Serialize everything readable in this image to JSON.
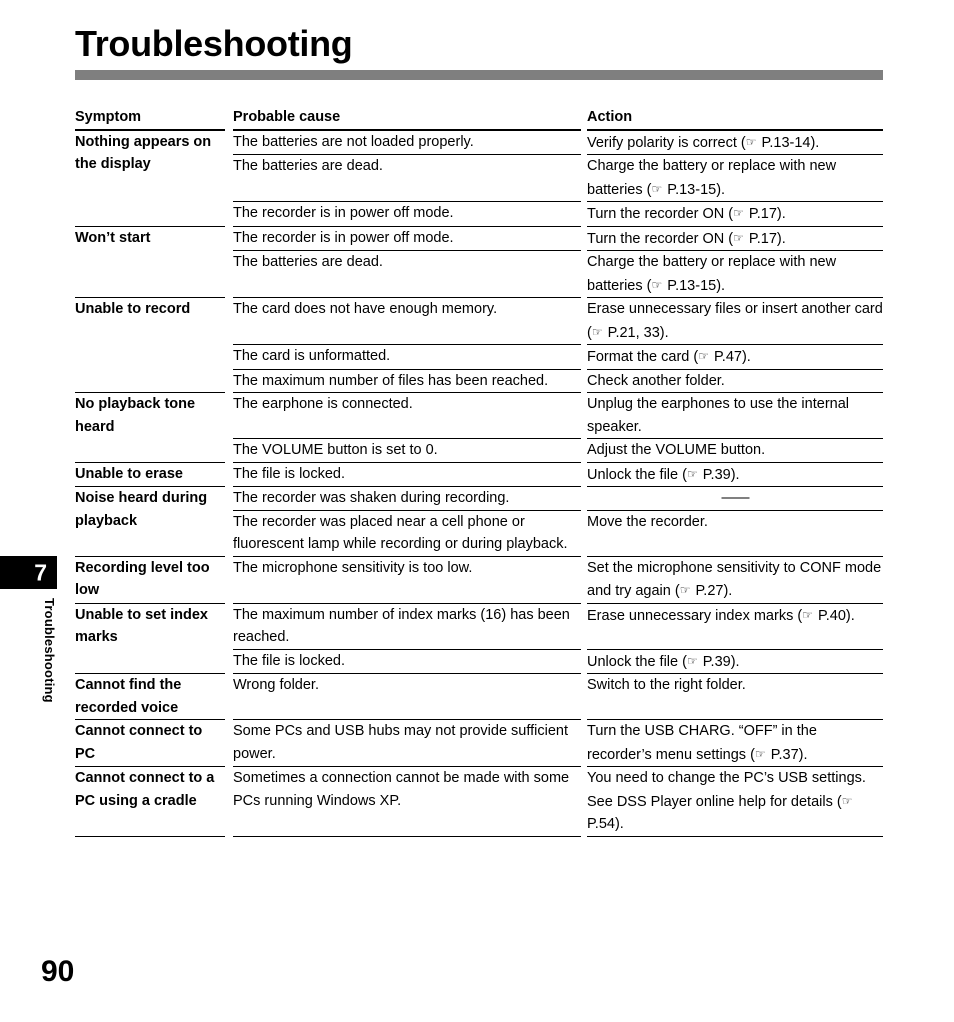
{
  "page": {
    "title": "Troubleshooting",
    "number": "90",
    "chapter_number": "7",
    "chapter_label": "Troubleshooting",
    "rule_color": "#7f7f7f"
  },
  "table": {
    "headers": {
      "symptom": "Symptom",
      "cause": "Probable cause",
      "action": "Action"
    },
    "hand_icon": "pointing-hand-icon",
    "hand_glyph": "☞",
    "rows": [
      {
        "symptom": "Nothing appears on the display",
        "entries": [
          {
            "cause": "The batteries are not loaded properly.",
            "action": "Verify polarity is correct (☞ P.13-14)."
          },
          {
            "cause": "The batteries are dead.",
            "action": "Charge the battery or replace with new batteries (☞ P.13-15)."
          },
          {
            "cause": "The recorder is in power off mode.",
            "action": "Turn the recorder ON (☞ P.17)."
          }
        ]
      },
      {
        "symptom": "Won’t start",
        "entries": [
          {
            "cause": "The recorder is in power off mode.",
            "action": "Turn the recorder ON (☞ P.17)."
          },
          {
            "cause": "The batteries are dead.",
            "action": "Charge the battery or replace with new batteries (☞ P.13-15)."
          }
        ]
      },
      {
        "symptom": "Unable to record",
        "entries": [
          {
            "cause": "The card does not have enough memory.",
            "action": "Erase unnecessary files or insert another card (☞ P.21, 33)."
          },
          {
            "cause": "The card is unformatted.",
            "action": "Format the card (☞ P.47)."
          },
          {
            "cause": "The maximum number of files has been reached.",
            "action": "Check another folder."
          }
        ]
      },
      {
        "symptom": "No playback tone heard",
        "entries": [
          {
            "cause": "The earphone is connected.",
            "action": "Unplug the earphones to use the internal speaker."
          },
          {
            "cause": "The VOLUME button is set to 0.",
            "action": "Adjust the VOLUME button."
          }
        ]
      },
      {
        "symptom": "Unable to erase",
        "entries": [
          {
            "cause": "The file is locked.",
            "action": "Unlock the file (☞ P.39)."
          }
        ]
      },
      {
        "symptom": "Noise heard during playback",
        "entries": [
          {
            "cause": "The recorder was shaken during recording.",
            "action": "——",
            "action_is_dash": true
          },
          {
            "cause": "The recorder was placed near a cell phone or fluorescent lamp while recording or during playback.",
            "action": "Move the recorder."
          }
        ]
      },
      {
        "symptom": "Recording level too low",
        "entries": [
          {
            "cause": "The microphone sensitivity is too low.",
            "action": "Set the microphone sensitivity to CONF mode and try again (☞ P.27)."
          }
        ]
      },
      {
        "symptom": "Unable to set index marks",
        "entries": [
          {
            "cause": "The maximum number of index marks (16) has been reached.",
            "action": "Erase unnecessary index marks (☞ P.40)."
          },
          {
            "cause": "The file is locked.",
            "action": "Unlock the file (☞ P.39)."
          }
        ]
      },
      {
        "symptom": "Cannot find the recorded voice",
        "entries": [
          {
            "cause": "Wrong folder.",
            "action": "Switch to the right folder."
          }
        ]
      },
      {
        "symptom": "Cannot connect to PC",
        "entries": [
          {
            "cause": "Some PCs and USB hubs may not provide sufficient power.",
            "action": "Turn the USB CHARG. “OFF” in the recorder’s menu settings (☞ P.37)."
          }
        ]
      },
      {
        "symptom": "Cannot connect to a PC using a cradle",
        "entries": [
          {
            "cause": "Sometimes a connection cannot be made with some PCs running Windows XP.",
            "action": "You need to change the PC’s USB settings. See DSS Player online help for details (☞ P.54)."
          }
        ]
      }
    ]
  }
}
